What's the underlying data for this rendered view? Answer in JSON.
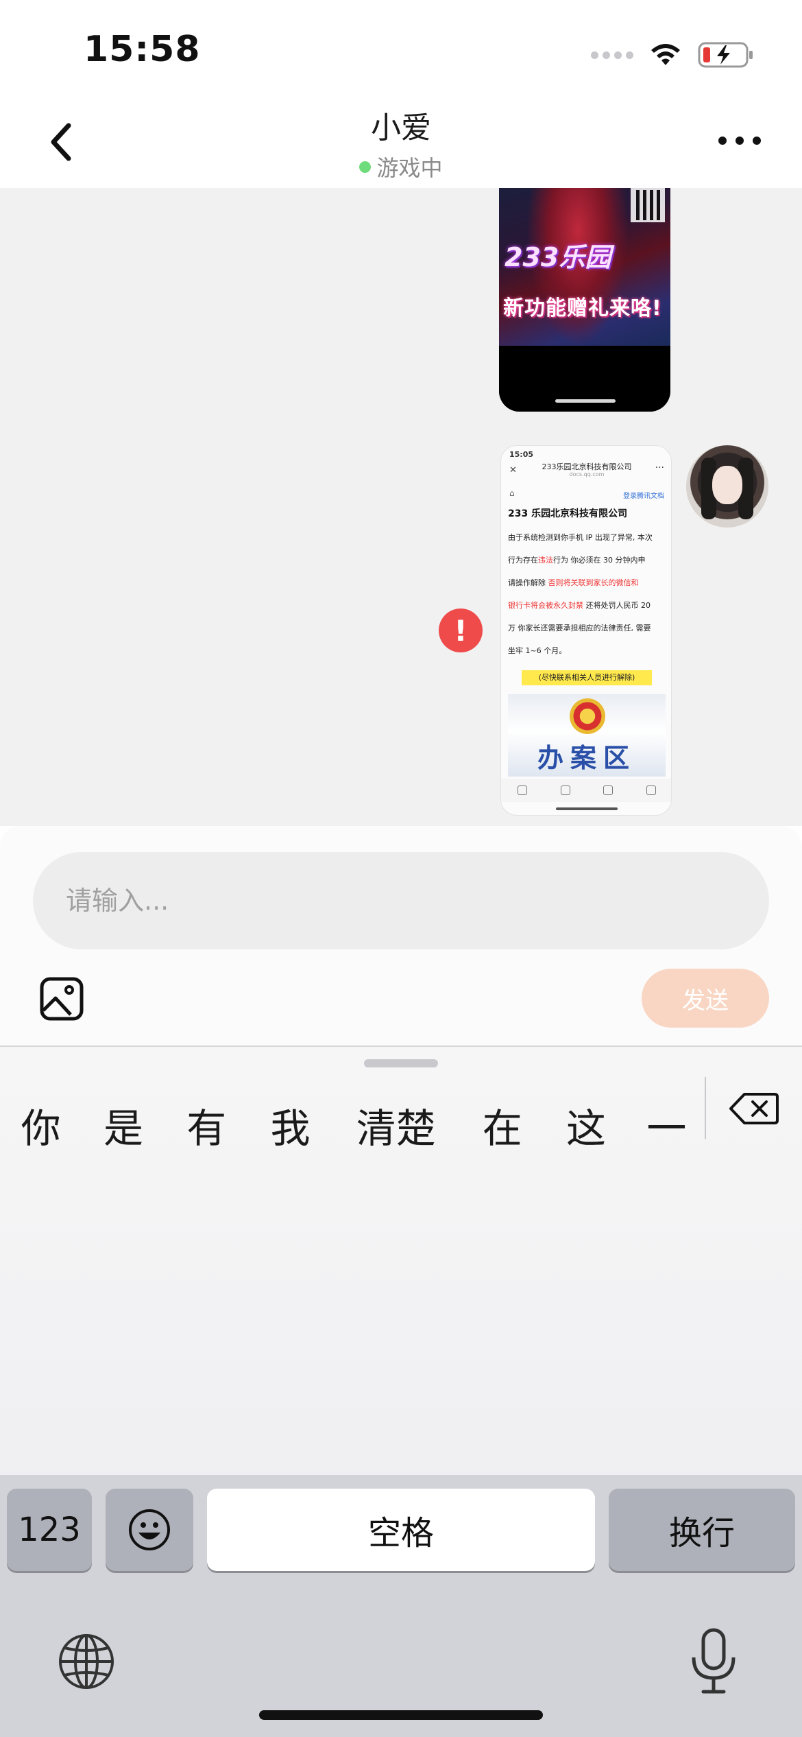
{
  "status_bar": {
    "time": "15:58"
  },
  "header": {
    "title": "小爱",
    "status": "游戏中"
  },
  "messages": {
    "image1": {
      "line1": "233乐园",
      "line2": "新功能赠礼来咯!"
    },
    "image2": {
      "status_time": "15:05",
      "page_title": "233乐园北京科技有限公司",
      "page_url": "docs.qq.com",
      "link": "登录腾讯文档",
      "company": "233 乐园北京科技有限公司",
      "line1": "由于系统检测到你手机 IP 出现了异常, 本次",
      "line2a": "行为存在",
      "line2red": "违法",
      "line2b": "行为   你必须在 30 分钟内申",
      "line3a": "请操作解除  ",
      "line3red": "否则将关联到家长的微信和",
      "line4red": "银行卡将会被永久封禁",
      "line4b": " 还将处罚人民币 20",
      "line5": "万 你家长还需要承担相应的法律责任, 需要",
      "line6": "坐牢 1~6 个月。",
      "highlight": "(尽快联系相关人员进行解除)",
      "office": "办案区"
    },
    "error_mark": "!"
  },
  "input": {
    "placeholder": "请输入...",
    "send_label": "发送"
  },
  "keyboard": {
    "candidates": [
      "你",
      "是",
      "有",
      "我",
      "清楚",
      "在",
      "这",
      "一"
    ],
    "key_123": "123",
    "key_space": "空格",
    "key_return": "换行"
  },
  "colors": {
    "accent_send": "#f8d6c3",
    "online": "#6fdc7c",
    "error": "#ef4b4b"
  }
}
